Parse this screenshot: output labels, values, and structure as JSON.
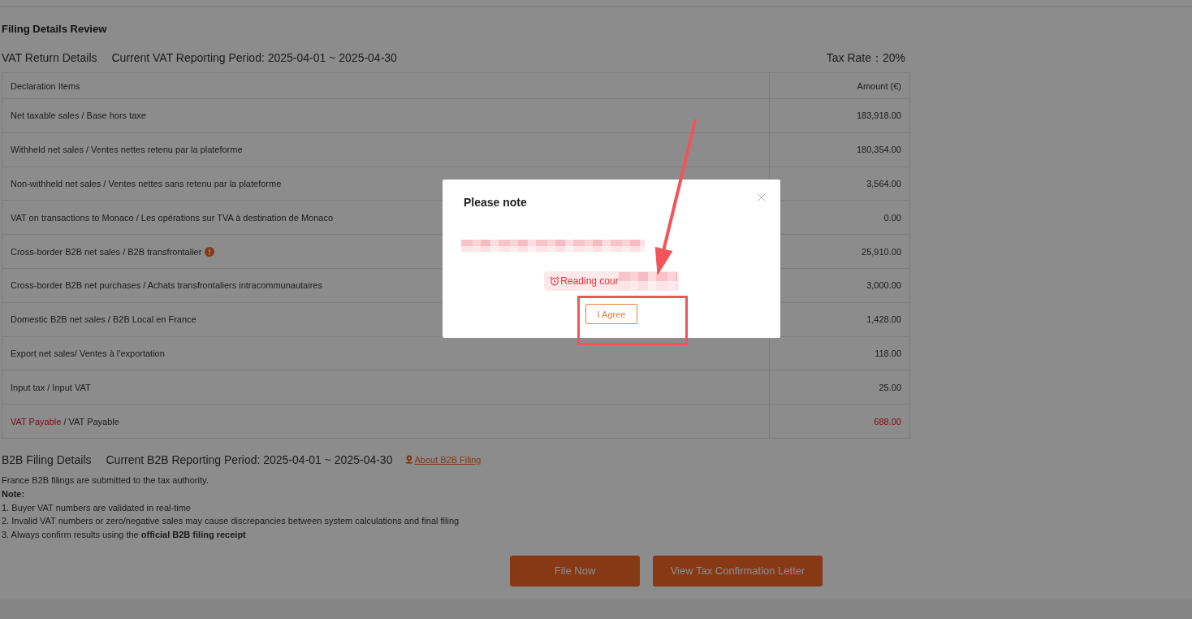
{
  "title": "Filing Details Review",
  "vat_return": {
    "heading": "VAT Return Details",
    "period": "Current VAT Reporting Period: 2025-04-01 ~ 2025-04-30",
    "tax_rate": "Tax Rate：20%"
  },
  "table": {
    "columns": [
      "Declaration Items",
      "Amount (€)"
    ],
    "rows": [
      {
        "kind": "item",
        "label": "Net taxable sales / Base hors taxe",
        "amount": "183,918.00",
        "info": false
      },
      {
        "kind": "item",
        "label": "Withheld net sales / Ventes nettes retenu par la plateforme",
        "amount": "180,354.00",
        "info": false
      },
      {
        "kind": "item",
        "label": "Non-withheld net sales / Ventes nettes sans retenu par la plateforme",
        "amount": "3,564.00",
        "info": false
      },
      {
        "kind": "item",
        "label": "VAT on transactions to Monaco / Les opérations sur TVA à destination de Monaco",
        "amount": "0.00",
        "info": false
      },
      {
        "kind": "item",
        "label": "Cross-border B2B net sales / B2B transfrontalier",
        "amount": "25,910.00",
        "info": true
      },
      {
        "kind": "item",
        "label": "Cross-border B2B net purchases / Achats transfrontaliers intracommunautaires",
        "amount": "3,000.00",
        "info": false
      },
      {
        "kind": "item",
        "label": "Domestic B2B net sales / B2B Local en France",
        "amount": "1,428.00",
        "info": false
      },
      {
        "kind": "item",
        "label": "Export net sales/ Ventes à l'exportation",
        "amount": "118.00",
        "info": false
      },
      {
        "kind": "item",
        "label": "Input tax / Input VAT",
        "amount": "25.00",
        "info": false
      },
      {
        "kind": "payable",
        "term": "VAT Payable",
        "label": "/ VAT Payable",
        "amount": "688.00",
        "info": false
      }
    ]
  },
  "b2b_filing": {
    "heading": "B2B Filing Details",
    "period": "Current B2B Reporting Period: 2025-04-01 ~ 2025-04-30",
    "link": "About B2B Filing",
    "intro": "France B2B filings are submitted to the tax authority.",
    "note_label": "Note:",
    "notes": [
      "1. Buyer VAT numbers are validated in real-time",
      "2. Invalid VAT numbers or zero/negative sales may cause discrepancies between system calculations and final filing",
      "3. Always confirm results using the **official B2B filing receipt**"
    ]
  },
  "actions": [
    "File Now",
    "View Tax Confirmation Letter"
  ],
  "dialog": {
    "open": true,
    "title": "Please note",
    "message": {
      "redacted": true
    },
    "countdown": {
      "text": "Reading cour",
      "redacted": true
    },
    "button": "I Agree"
  },
  "annotations": {
    "arrow": true,
    "highlight_frame": true
  }
}
